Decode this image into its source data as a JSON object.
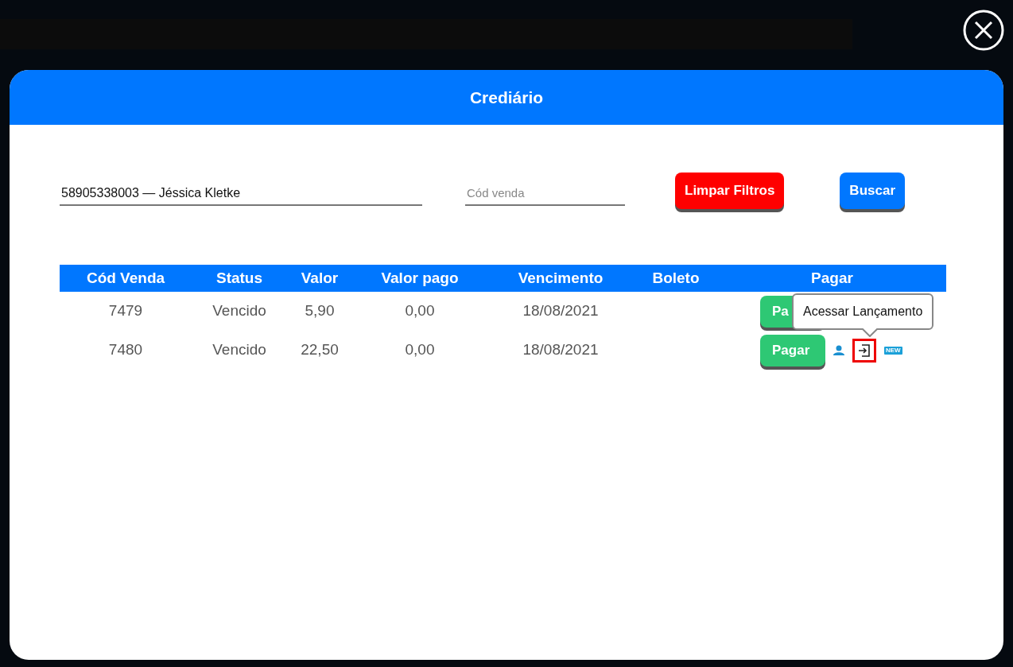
{
  "modal": {
    "title": "Crediário"
  },
  "filters": {
    "client": {
      "value": "58905338003 — Jéssica Kletke"
    },
    "sale_code": {
      "placeholder": "Cód venda"
    },
    "buttons": [
      {
        "label": "Limpar Filtros",
        "kind": "danger"
      },
      {
        "label": "Buscar",
        "kind": "primary"
      }
    ]
  },
  "table": {
    "columns": [
      "Cód Venda",
      "Status",
      "Valor",
      "Valor pago",
      "Vencimento",
      "Boleto",
      "Pagar"
    ],
    "rows": [
      {
        "cod": "7479",
        "status": "Vencido",
        "valor": "5,90",
        "valor_pago": "0,00",
        "vencimento": "18/08/2021",
        "pay_label": "Pa"
      },
      {
        "cod": "7480",
        "status": "Vencido",
        "valor": "22,50",
        "valor_pago": "0,00",
        "vencimento": "18/08/2021",
        "pay_label": "Pagar",
        "actions": {
          "new_badge": "NEW",
          "access_highlighted": true,
          "tooltip": "Acessar Lançamento"
        }
      }
    ]
  }
}
